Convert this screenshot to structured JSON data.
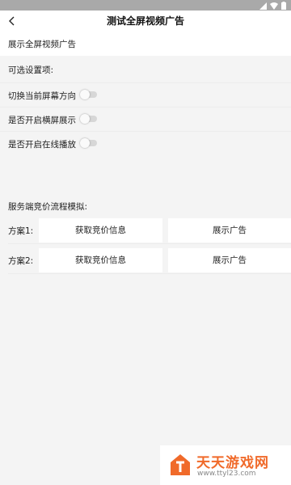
{
  "title_bar": {
    "title": "测试全屏视频广告"
  },
  "header": {
    "label": "展示全屏视频广告"
  },
  "options": {
    "section_label": "可选设置项:",
    "items": [
      {
        "label": "切换当前屏幕方向",
        "enabled": false
      },
      {
        "label": "是否开启横屏展示",
        "enabled": false
      },
      {
        "label": "是否开启在线播放",
        "enabled": false
      }
    ]
  },
  "bidding": {
    "section_label": "服务端竞价流程模拟:",
    "plans": [
      {
        "label": "方案1:",
        "fetch_label": "获取竞价信息",
        "show_label": "展示广告"
      },
      {
        "label": "方案2:",
        "fetch_label": "获取竞价信息",
        "show_label": "展示广告"
      }
    ]
  },
  "watermark": {
    "main": "天天游戏网",
    "sub": "www.ttyl23.com"
  },
  "colors": {
    "accent": "#f06a2a",
    "background": "#f4f4f4",
    "status_bar": "#a9a9a9"
  }
}
